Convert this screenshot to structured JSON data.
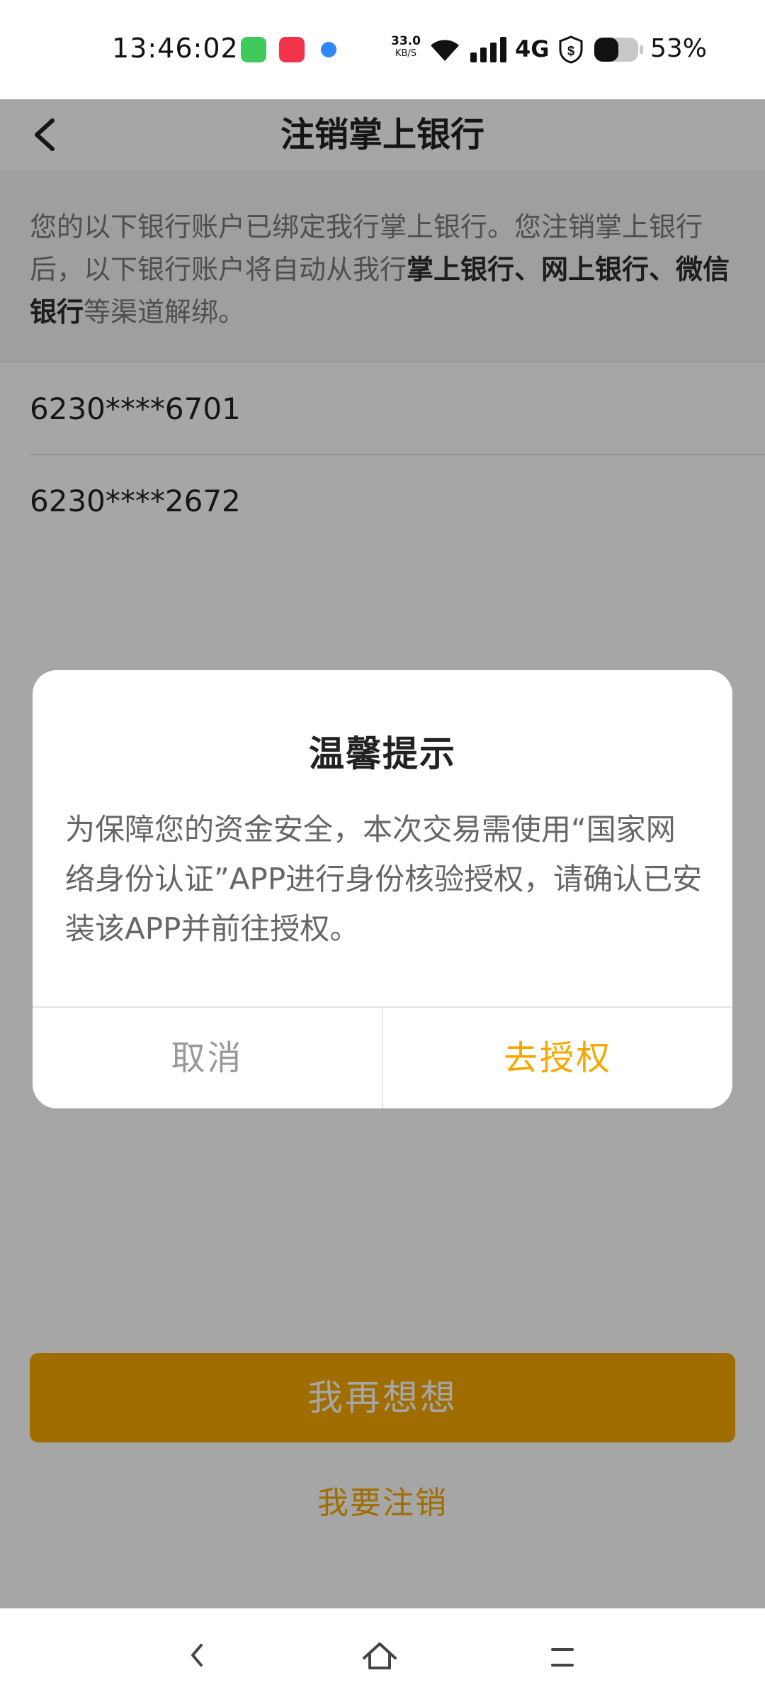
{
  "status_bar": {
    "time": "13:46:02",
    "net_speed_value": "33.0",
    "net_speed_unit": "KB/S",
    "network_type": "4G",
    "battery_percent": "53%",
    "icons": [
      "messages-app-icon",
      "music-app-icon",
      "browser-app-icon",
      "wifi-icon",
      "signal-icon",
      "shield-dollar-icon",
      "battery-icon"
    ]
  },
  "header": {
    "title": "注销掌上银行",
    "back_icon": "chevron-left-icon"
  },
  "notice": {
    "text_1": "您的以下银行账户已绑定我行掌上银行。您注销掌上银行后，以下银行账户将自动从我行",
    "bold_1": "掌上银行、网上银行、微信银行",
    "text_2": "等渠道解绑。"
  },
  "accounts": [
    "6230****6701",
    "6230****2672"
  ],
  "actions": {
    "primary_label": "我再想想",
    "secondary_label": "我要注销"
  },
  "dialog": {
    "title": "温馨提示",
    "message": "为保障您的资金安全，本次交易需使用“国家网络身份认证”APP进行身份核验授权，请确认已安装该APP并前往授权。",
    "cancel_label": "取消",
    "confirm_label": "去授权"
  },
  "nav_bar": {
    "icons": [
      "back-nav-icon",
      "home-nav-icon",
      "menu-nav-icon"
    ]
  },
  "colors": {
    "accent": "#f4a800",
    "overlay": "rgba(0,0,0,0.35)"
  }
}
